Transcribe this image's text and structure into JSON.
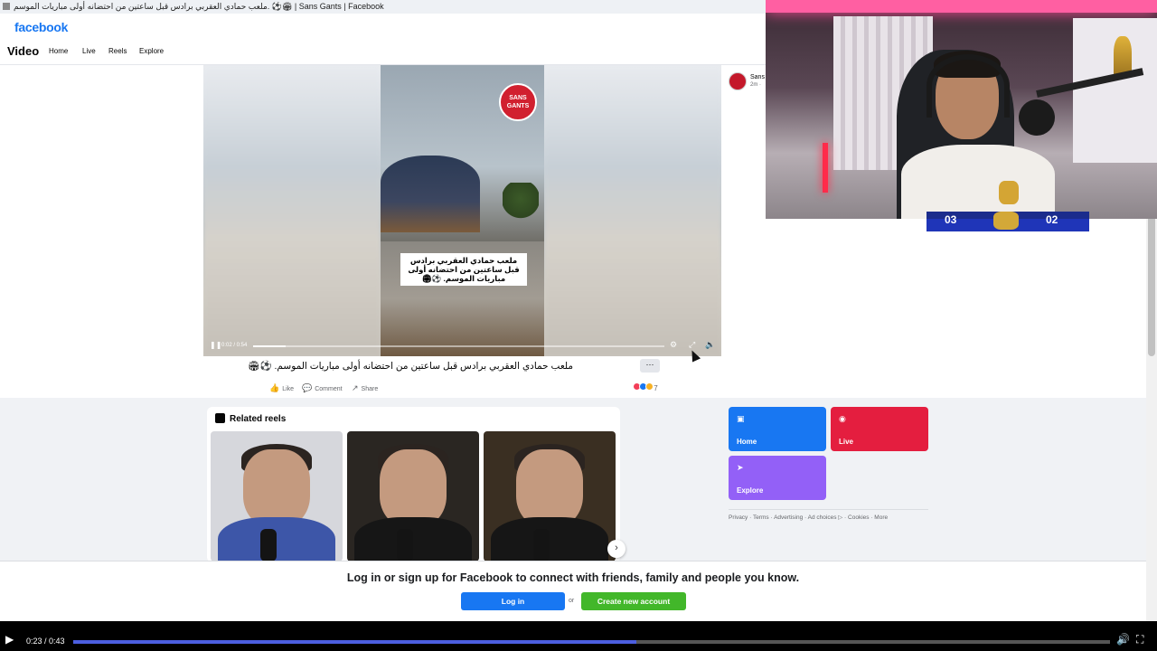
{
  "browser": {
    "tab_title": "ملعب حمادي العقربي برادس قبل ساعتين من احتضانه أولى مباريات الموسم. ⚽🏟 | Sans Gants | Facebook"
  },
  "header": {
    "logo": "facebook"
  },
  "video_nav": {
    "title": "Video",
    "links": [
      "Home",
      "Live",
      "Reels",
      "Explore"
    ]
  },
  "player": {
    "brand_logo": "SANS GANTS",
    "caption": "ملعب حمادي العقربي برادس قبل ساعتين من احتضانه أولى مباريات الموسم. ⚽🏟",
    "time": "0:02 / 0:54",
    "progress": 0.08,
    "icons": [
      "pause-icon",
      "settings-icon",
      "fullscreen-icon",
      "volume-mute-icon"
    ]
  },
  "post": {
    "title": "ملعب حمادي العقربي برادس قبل ساعتين من احتضانه أولى مباريات الموسم. ⚽🏟",
    "more_label": "···",
    "actions": [
      "Like",
      "Comment",
      "Share"
    ],
    "reaction_count": "7",
    "owner_name": "Sans",
    "owner_meta": "2m ·"
  },
  "related_reels": {
    "title": "Related reels",
    "items": [
      {
        "shirt": "#3d56a8",
        "bg": "#d6d7dc"
      },
      {
        "shirt": "#161616",
        "bg": "#2a2622"
      },
      {
        "shirt": "#161616",
        "bg": "#3a2f22"
      }
    ]
  },
  "tiles": [
    {
      "label": "Home",
      "color": "#1877f2",
      "icon": "video-icon"
    },
    {
      "label": "Live",
      "color": "#e41e3f",
      "icon": "live-icon"
    },
    {
      "label": "Explore",
      "color": "#9360f7",
      "icon": "explore-icon"
    }
  ],
  "footer_links": "Privacy · Terms · Advertising · Ad choices ▷ · Cookies · More",
  "login_banner": {
    "text": "Log in or sign up for Facebook to connect with friends, family and people you know.",
    "login_label": "Log in",
    "or_label": "or",
    "create_label": "Create new account"
  },
  "webcam_overlay": {
    "score_left": "03",
    "score_right": "02"
  },
  "media_player": {
    "time": "0:23 / 0:43",
    "progress": 0.543
  },
  "colors": {
    "fb_blue": "#1877f2",
    "fb_green": "#42b72a",
    "media_accent": "#4c5fe0"
  }
}
